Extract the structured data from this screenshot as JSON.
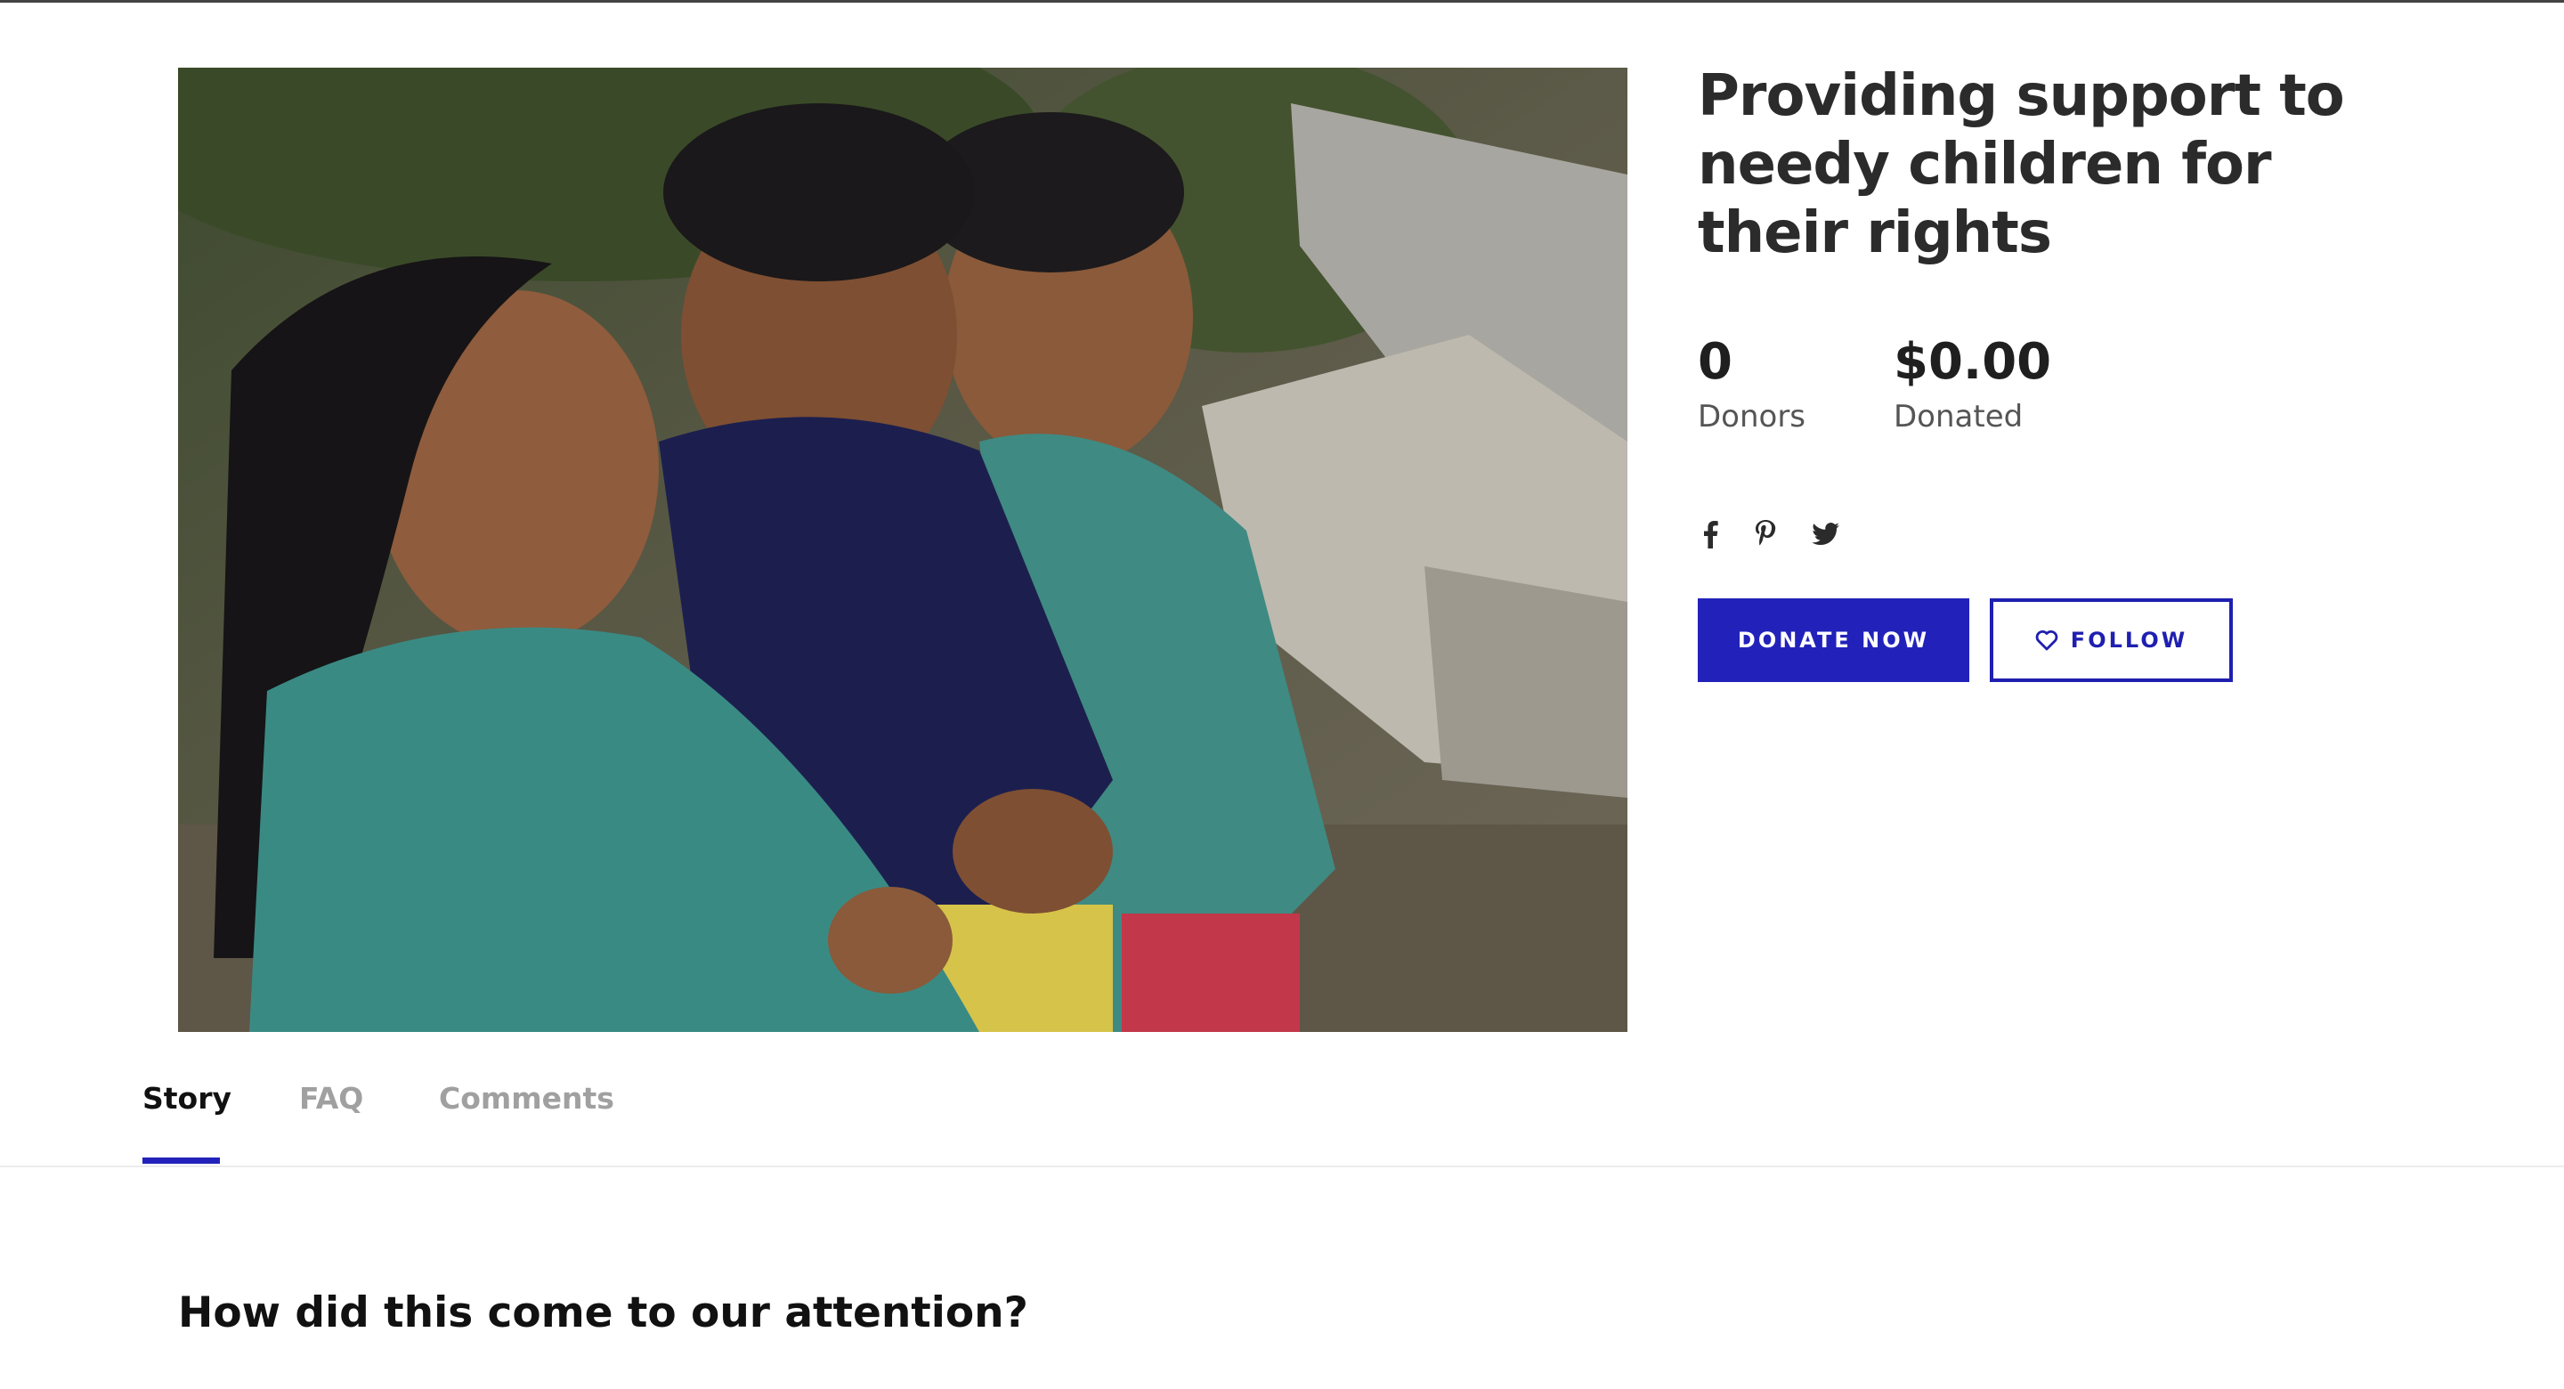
{
  "campaign": {
    "title": "Providing support to needy children for their rights",
    "image_description_icon": "photo-children"
  },
  "stats": {
    "donors_value": "0",
    "donors_label": "Donors",
    "donated_value": "$0.00",
    "donated_label": "Donated"
  },
  "social": {
    "icons": [
      "facebook-icon",
      "pinterest-icon",
      "twitter-icon"
    ]
  },
  "actions": {
    "donate_label": "DONATE NOW",
    "follow_label": "FOLLOW"
  },
  "tabs": [
    {
      "label": "Story",
      "active": true
    },
    {
      "label": "FAQ",
      "active": false
    },
    {
      "label": "Comments",
      "active": false
    }
  ],
  "story": {
    "heading": "How did this come to our attention?"
  },
  "colors": {
    "accent": "#2222bb",
    "text": "#222222",
    "muted_tab": "#a0a0a0"
  }
}
